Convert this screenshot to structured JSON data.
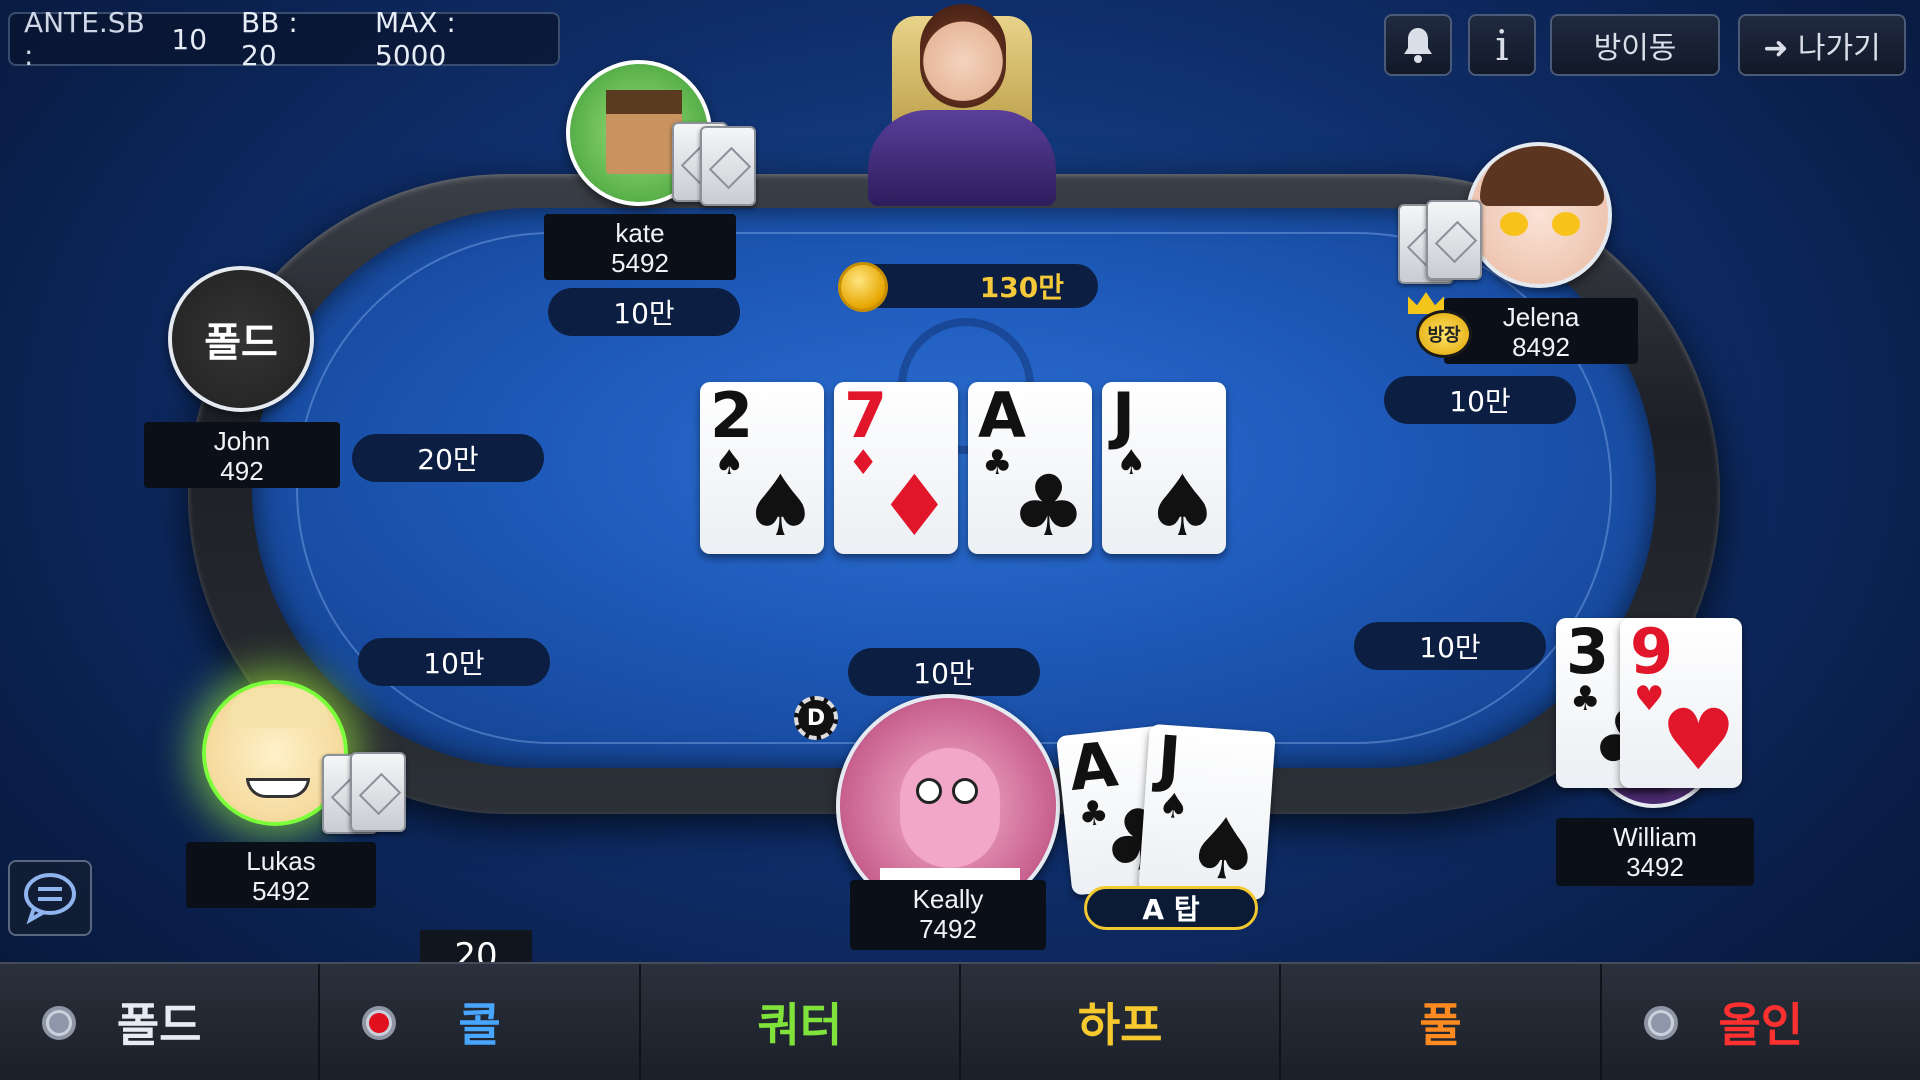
{
  "blinds": {
    "ante_label": "ANTE.SB :",
    "ante_value": "10",
    "bb_label": "BB : 20",
    "max_label": "MAX : 5000"
  },
  "top_buttons": {
    "info_label": "i",
    "move_room_label": "방이동",
    "exit_label": "➜ 나가기"
  },
  "pot": {
    "amount": "130만"
  },
  "community_cards": [
    {
      "rank": "2",
      "suit": "♠",
      "color": "black"
    },
    {
      "rank": "7",
      "suit": "♦",
      "color": "red"
    },
    {
      "rank": "A",
      "suit": "♣",
      "color": "black"
    },
    {
      "rank": "J",
      "suit": "♠",
      "color": "black"
    }
  ],
  "players": {
    "kate": {
      "name": "kate",
      "chips": "5492",
      "bet": "10만"
    },
    "john": {
      "name": "John",
      "chips": "492",
      "bet": "20만",
      "status": "폴드"
    },
    "jelena": {
      "name": "Jelena",
      "chips": "8492",
      "bet": "10만",
      "badge": "방장"
    },
    "lukas": {
      "name": "Lukas",
      "chips": "5492",
      "bet": "10만"
    },
    "keally": {
      "name": "Keally",
      "chips": "7492",
      "bet": "10만",
      "hand_rank": "A 탑",
      "cards": [
        {
          "rank": "A",
          "suit": "♣"
        },
        {
          "rank": "J",
          "suit": "♠"
        }
      ]
    },
    "william": {
      "name": "William",
      "chips": "3492",
      "bet": "10만",
      "cards": [
        {
          "rank": "3",
          "suit": "♣"
        },
        {
          "rank": "9",
          "suit": "♥"
        }
      ]
    }
  },
  "dealer_button": "D",
  "call_amount": "20",
  "actions": [
    {
      "label": "폴드",
      "color": "#e8ecf2"
    },
    {
      "label": "콜",
      "color": "#49a6ff"
    },
    {
      "label": "쿼터",
      "color": "#7fe33b"
    },
    {
      "label": "하프",
      "color": "#f6c92e"
    },
    {
      "label": "풀",
      "color": "#ff8a1f"
    },
    {
      "label": "올인",
      "color": "#ff3030"
    }
  ],
  "colors": {
    "accent_gold": "#f5c93a",
    "felt": "#1f5bbb"
  }
}
